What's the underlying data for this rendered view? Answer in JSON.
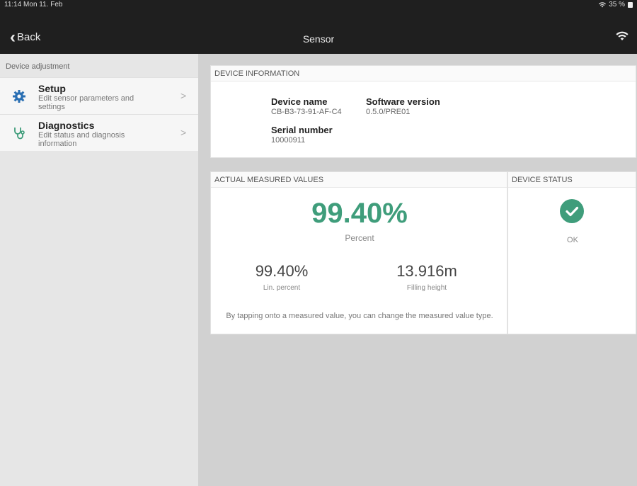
{
  "statusbar": {
    "time": "11:14  Mon 11. Feb",
    "battery": "35 %"
  },
  "nav": {
    "back_label": "Back",
    "title": "Sensor"
  },
  "sidebar": {
    "header": "Device adjustment",
    "items": [
      {
        "title": "Setup",
        "subtitle": "Edit sensor parameters and settings"
      },
      {
        "title": "Diagnostics",
        "subtitle": "Edit status and diagnosis information"
      }
    ]
  },
  "device_info": {
    "header": "DEVICE INFORMATION",
    "device_name_label": "Device name",
    "device_name": "CB-B3-73-91-AF-C4",
    "software_version_label": "Software version",
    "software_version": "0.5.0/PRE01",
    "serial_number_label": "Serial number",
    "serial_number": "10000911"
  },
  "measured": {
    "header": "ACTUAL MEASURED VALUES",
    "primary_value": "99.40%",
    "primary_label": "Percent",
    "secondary_value": "99.40%",
    "secondary_label": "Lin. percent",
    "tertiary_value": "13.916m",
    "tertiary_label": "Filling height",
    "hint": "By tapping onto a measured value, you can change the measured value type."
  },
  "device_status": {
    "header": "DEVICE STATUS",
    "status": "OK"
  },
  "colors": {
    "accent": "#3f9d7b",
    "navbar": "#1f1f1f",
    "setup_icon": "#2a6fb3",
    "diagnostics_icon": "#3f9d7b"
  }
}
